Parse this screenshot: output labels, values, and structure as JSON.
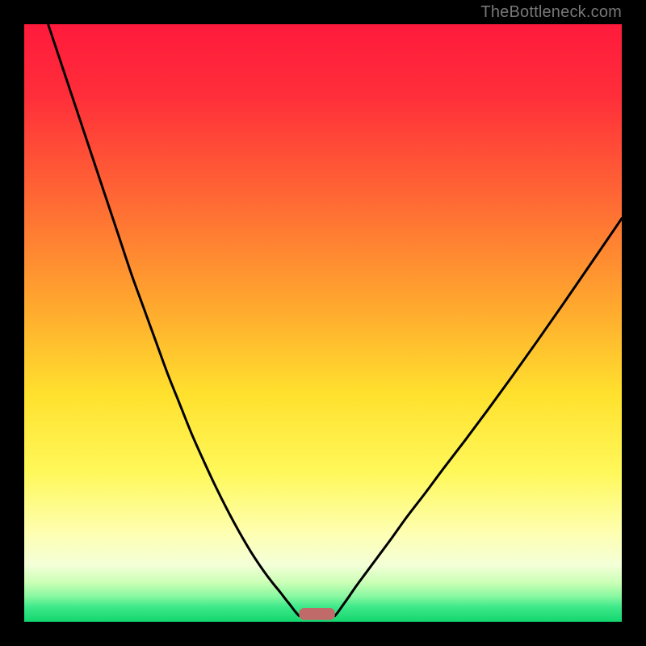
{
  "watermark": "TheBottleneck.com",
  "chart_data": {
    "type": "line",
    "title": "",
    "xlabel": "",
    "ylabel": "",
    "xlim": [
      0,
      100
    ],
    "ylim": [
      0,
      100
    ],
    "gradient_stops": [
      {
        "offset": 0.0,
        "color": "#ff1a3c"
      },
      {
        "offset": 0.12,
        "color": "#ff2e3a"
      },
      {
        "offset": 0.3,
        "color": "#ff6b34"
      },
      {
        "offset": 0.48,
        "color": "#ffab2e"
      },
      {
        "offset": 0.62,
        "color": "#ffe12e"
      },
      {
        "offset": 0.75,
        "color": "#fff85a"
      },
      {
        "offset": 0.85,
        "color": "#feffb0"
      },
      {
        "offset": 0.905,
        "color": "#f4ffd8"
      },
      {
        "offset": 0.935,
        "color": "#c9ffb5"
      },
      {
        "offset": 0.958,
        "color": "#86f7a0"
      },
      {
        "offset": 0.975,
        "color": "#3fe98a"
      },
      {
        "offset": 1.0,
        "color": "#12d56e"
      }
    ],
    "series": [
      {
        "name": "left-curve",
        "x": [
          4,
          6,
          8,
          10,
          12,
          14,
          16,
          18,
          20,
          22,
          24,
          26,
          28,
          30,
          32,
          34,
          36,
          38,
          40,
          41.5,
          42.8,
          43.8,
          44.6,
          45.2,
          45.7,
          46.0
        ],
        "y": [
          100,
          94,
          88,
          82,
          76,
          70,
          64,
          58,
          52.5,
          47,
          41.5,
          36.5,
          31.5,
          27,
          22.7,
          18.7,
          15.0,
          11.6,
          8.6,
          6.6,
          5.0,
          3.7,
          2.7,
          1.9,
          1.3,
          1.0
        ]
      },
      {
        "name": "right-curve",
        "x": [
          52.0,
          52.5,
          53.2,
          54.2,
          55.5,
          57.2,
          59.2,
          61.5,
          64.0,
          67.0,
          70.2,
          73.8,
          77.6,
          81.6,
          85.8,
          90.2,
          94.8,
          100.0
        ],
        "y": [
          1.0,
          1.6,
          2.6,
          4.0,
          5.9,
          8.2,
          10.9,
          14.0,
          17.5,
          21.4,
          25.7,
          30.4,
          35.5,
          41.0,
          46.9,
          53.2,
          59.9,
          67.5
        ]
      }
    ],
    "marker": {
      "name": "bottleneck-marker",
      "x_center": 49.0,
      "width": 6.0,
      "y": 0.3,
      "height": 2.0,
      "color": "#c16a6a"
    }
  }
}
